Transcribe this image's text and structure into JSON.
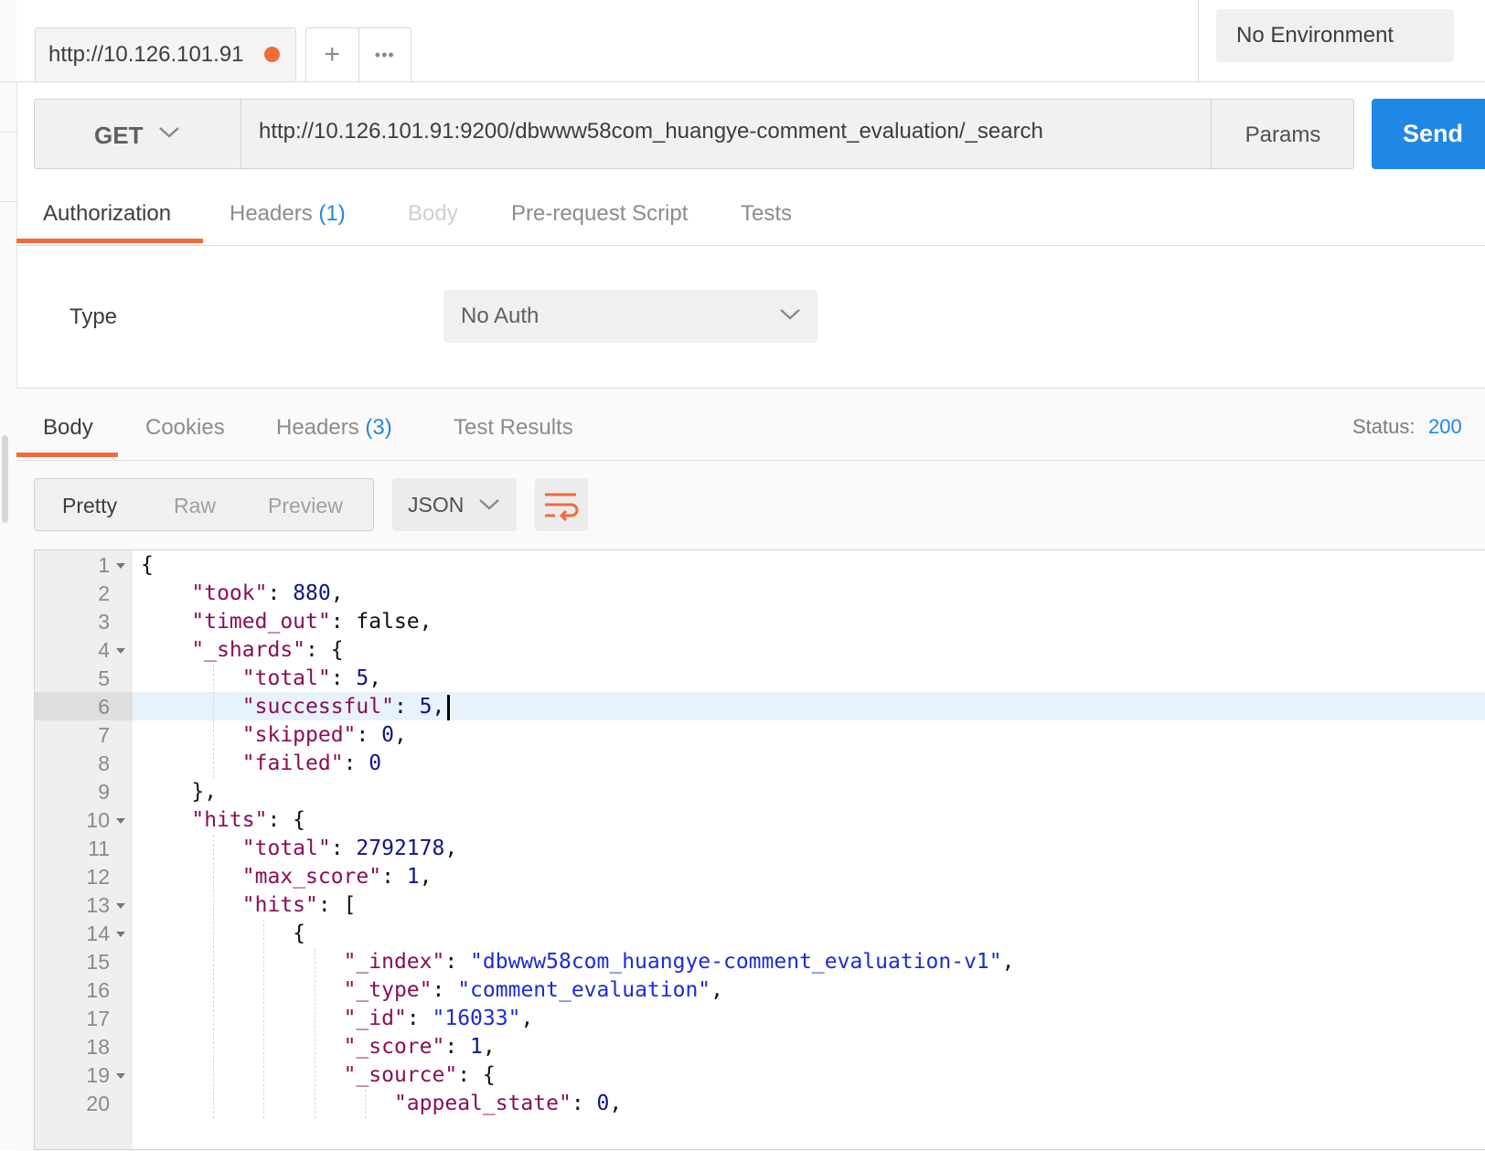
{
  "request_tab": {
    "title": "http://10.126.101.91",
    "unsaved_dot_color": "#f26b3a"
  },
  "tab_actions": {
    "new_tab": "+",
    "more": "•••"
  },
  "environment": {
    "selected": "No Environment"
  },
  "request": {
    "method": "GET",
    "url": "http://10.126.101.91:9200/dbwww58com_huangye-comment_evaluation/_search",
    "params_label": "Params",
    "send_label": "Send"
  },
  "request_tabs": [
    {
      "label": "Authorization",
      "active": true
    },
    {
      "label": "Headers",
      "count": "(1)"
    },
    {
      "label": "Body",
      "disabled": true
    },
    {
      "label": "Pre-request Script"
    },
    {
      "label": "Tests"
    }
  ],
  "auth": {
    "type_label": "Type",
    "selected": "No Auth"
  },
  "response_tabs": [
    {
      "label": "Body",
      "active": true
    },
    {
      "label": "Cookies"
    },
    {
      "label": "Headers",
      "count": "(3)"
    },
    {
      "label": "Test Results"
    }
  ],
  "status": {
    "label": "Status:",
    "value": "200"
  },
  "view_modes": [
    "Pretty",
    "Raw",
    "Preview"
  ],
  "active_view_mode": "Pretty",
  "format": {
    "selected": "JSON"
  },
  "editor": {
    "cursor_line": 6,
    "lines": [
      "{",
      "    \"took\": 880,",
      "    \"timed_out\": false,",
      "    \"_shards\": {",
      "        \"total\": 5,",
      "        \"successful\": 5,",
      "        \"skipped\": 0,",
      "        \"failed\": 0",
      "    },",
      "    \"hits\": {",
      "        \"total\": 2792178,",
      "        \"max_score\": 1,",
      "        \"hits\": [",
      "            {",
      "                \"_index\": \"dbwww58com_huangye-comment_evaluation-v1\",",
      "                \"_type\": \"comment_evaluation\",",
      "                \"_id\": \"16033\",",
      "                \"_score\": 1,",
      "                \"_source\": {",
      "                    \"appeal_state\": 0,"
    ],
    "foldable_lines": [
      1,
      4,
      10,
      13,
      14,
      19
    ]
  },
  "colors": {
    "accent": "#f26b3a",
    "primary": "#1f87e5",
    "json_key": "#880e56",
    "json_number": "#12118a",
    "json_string": "#1b2bd6"
  }
}
